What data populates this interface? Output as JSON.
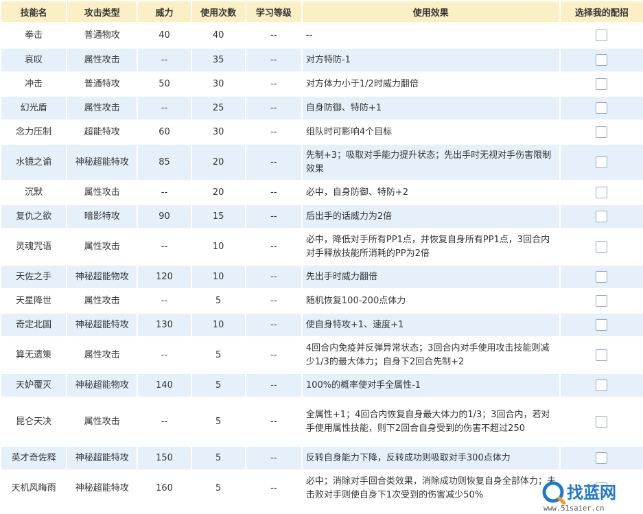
{
  "headers": [
    "技能名",
    "攻击类型",
    "威力",
    "使用次数",
    "学习等级",
    "使用效果",
    "选择我的配招"
  ],
  "rows": [
    {
      "name": "拳击",
      "type": "普通物攻",
      "power": "40",
      "uses": "40",
      "level": "--",
      "effect": "--"
    },
    {
      "name": "哀叹",
      "type": "属性攻击",
      "power": "--",
      "uses": "35",
      "level": "--",
      "effect": "对方特防-1"
    },
    {
      "name": "冲击",
      "type": "普通特攻",
      "power": "50",
      "uses": "30",
      "level": "--",
      "effect": "对方体力小于1/2时威力翻倍"
    },
    {
      "name": "幻光盾",
      "type": "属性攻击",
      "power": "--",
      "uses": "25",
      "level": "--",
      "effect": "自身防御、特防+1"
    },
    {
      "name": "念力压制",
      "type": "超能特攻",
      "power": "60",
      "uses": "30",
      "level": "--",
      "effect": "组队时可影响4个目标"
    },
    {
      "name": "水镜之谕",
      "type": "神秘超能特攻",
      "power": "85",
      "uses": "20",
      "level": "--",
      "effect": "先制+3；吸取对手能力提升状态；先出手时无视对手伤害限制效果"
    },
    {
      "name": "沉默",
      "type": "属性攻击",
      "power": "--",
      "uses": "20",
      "level": "--",
      "effect": "必中，自身防御、特防+2"
    },
    {
      "name": "复仇之欲",
      "type": "暗影特攻",
      "power": "90",
      "uses": "15",
      "level": "--",
      "effect": "后出手的话威力为2倍"
    },
    {
      "name": "灵魂咒语",
      "type": "属性攻击",
      "power": "--",
      "uses": "10",
      "level": "--",
      "effect": "必中，降低对手所有PP1点，并恢复自身所有PP1点，3回合内对手释放技能所消耗的PP为2倍"
    },
    {
      "name": "天佐之手",
      "type": "神秘超能物攻",
      "power": "120",
      "uses": "10",
      "level": "--",
      "effect": "先出手时威力翻倍"
    },
    {
      "name": "天星降世",
      "type": "属性攻击",
      "power": "--",
      "uses": "5",
      "level": "--",
      "effect": "随机恢复100-200点体力"
    },
    {
      "name": "奇定北国",
      "type": "神秘超能特攻",
      "power": "130",
      "uses": "10",
      "level": "--",
      "effect": "使自身特攻+1、速度+1"
    },
    {
      "name": "算无遗策",
      "type": "属性攻击",
      "power": "--",
      "uses": "5",
      "level": "--",
      "effect": "4回合内免疫并反弹异常状态；3回合内对手使用攻击技能则减少1/3的最大体力；自身下2回合先制+2"
    },
    {
      "name": "天妒覆灭",
      "type": "神秘超能物攻",
      "power": "140",
      "uses": "5",
      "level": "--",
      "effect": "100%的概率使对手全属性-1"
    },
    {
      "name": "昆仑天决",
      "type": "属性攻击",
      "power": "--",
      "uses": "5",
      "level": "--",
      "effect": "全属性+1；4回合内恢复自身最大体力的1/3；3回合内，若对手使用属性技能，则下2回合自身受到的伤害不超过250"
    },
    {
      "name": "英才奇佐释",
      "type": "神秘超能特攻",
      "power": "150",
      "uses": "5",
      "level": "--",
      "effect": "反转自身能力下降，反转成功则吸取对手300点体力"
    },
    {
      "name": "天机风晦雨",
      "type": "神秘超能特攻",
      "power": "160",
      "uses": "5",
      "level": "--",
      "effect": "必中；消除对手回合类效果，消除成功则恢复自身全部体力；未击败对手则使自身下1次受到的伤害减少50%"
    }
  ],
  "watermark": {
    "brand": "找蓝网",
    "url": "www.51saier.cn"
  },
  "colors": {
    "header_bg": "#fbf0c4",
    "row_alt_bg": "#e6f0fa",
    "checkbox_border": "#8fa9c8",
    "watermark_blue": "#1e78d2",
    "watermark_orange": "#f39a1e"
  }
}
